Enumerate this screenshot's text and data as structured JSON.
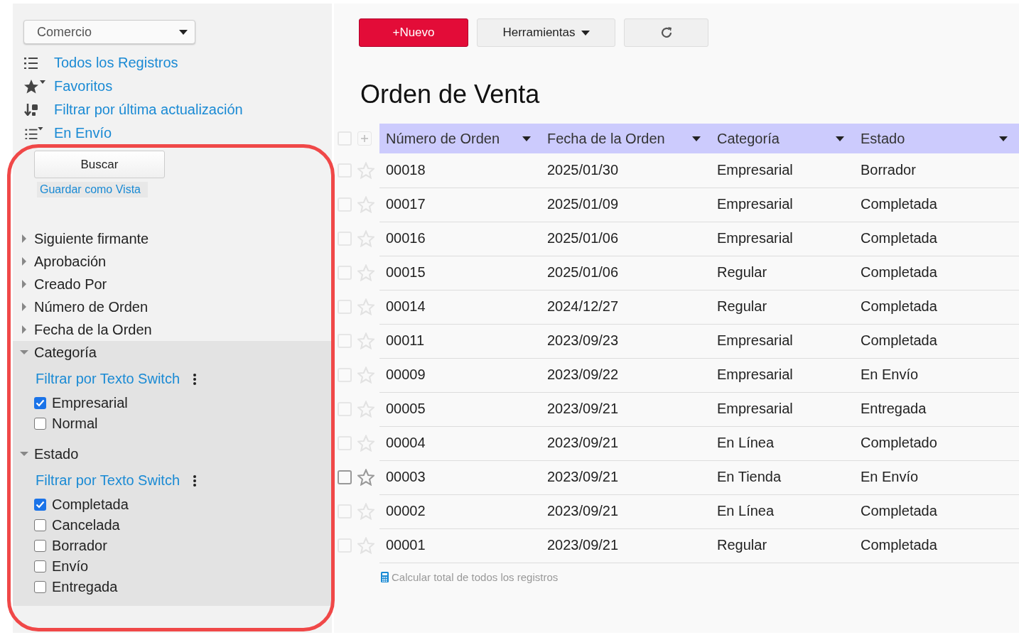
{
  "sidebar": {
    "app_select": {
      "value": "Comercio"
    },
    "nav": [
      {
        "kind": "list",
        "label": "Todos los Registros"
      },
      {
        "kind": "star",
        "label": "Favoritos"
      },
      {
        "kind": "sort",
        "label": "Filtrar por última actualización"
      },
      {
        "kind": "listfilter",
        "label": "En Envío"
      }
    ],
    "search_button": "Buscar",
    "save_view": "Guardar como Vista",
    "filters": [
      {
        "label": "Siguiente firmante",
        "expanded": false
      },
      {
        "label": "Aprobación",
        "expanded": false
      },
      {
        "label": "Creado Por",
        "expanded": false
      },
      {
        "label": "Número de Orden",
        "expanded": false
      },
      {
        "label": "Fecha de la Orden",
        "expanded": false
      },
      {
        "label": "Categoría",
        "expanded": true,
        "switch_label": "Filtrar por Texto Switch",
        "options": [
          {
            "label": "Empresarial",
            "checked": true
          },
          {
            "label": "Normal",
            "checked": false
          }
        ]
      },
      {
        "label": "Estado",
        "expanded": true,
        "switch_label": "Filtrar por Texto Switch",
        "options": [
          {
            "label": "Completada",
            "checked": true
          },
          {
            "label": "Cancelada",
            "checked": false
          },
          {
            "label": "Borrador",
            "checked": false
          },
          {
            "label": "Envío",
            "checked": false
          },
          {
            "label": "Entregada",
            "checked": false
          }
        ]
      }
    ]
  },
  "toolbar": {
    "new_button": "+Nuevo",
    "tools_button": "Herramientas"
  },
  "title": "Orden de Venta",
  "table": {
    "columns": [
      "Número de Orden",
      "Fecha de la Orden",
      "Categoría",
      "Estado"
    ],
    "select_all": {
      "checked": false
    },
    "rows": [
      {
        "cells": [
          "00018",
          "2025/01/30",
          "Empresarial",
          "Borrador"
        ],
        "checked": false,
        "hovered": false
      },
      {
        "cells": [
          "00017",
          "2025/01/09",
          "Empresarial",
          "Completada"
        ],
        "checked": false,
        "hovered": false
      },
      {
        "cells": [
          "00016",
          "2025/01/06",
          "Empresarial",
          "Completada"
        ],
        "checked": false,
        "hovered": false
      },
      {
        "cells": [
          "00015",
          "2025/01/06",
          "Regular",
          "Completada"
        ],
        "checked": false,
        "hovered": false
      },
      {
        "cells": [
          "00014",
          "2024/12/27",
          "Regular",
          "Completada"
        ],
        "checked": false,
        "hovered": false
      },
      {
        "cells": [
          "00011",
          "2023/09/23",
          "Empresarial",
          "Completada"
        ],
        "checked": false,
        "hovered": false
      },
      {
        "cells": [
          "00009",
          "2023/09/22",
          "Empresarial",
          "En Envío"
        ],
        "checked": false,
        "hovered": false
      },
      {
        "cells": [
          "00005",
          "2023/09/21",
          "Empresarial",
          "Entregada"
        ],
        "checked": false,
        "hovered": false
      },
      {
        "cells": [
          "00004",
          "2023/09/21",
          "En Línea",
          "Completado"
        ],
        "checked": false,
        "hovered": false
      },
      {
        "cells": [
          "00003",
          "2023/09/21",
          "En Tienda",
          "En Envío"
        ],
        "checked": false,
        "hovered": true
      },
      {
        "cells": [
          "00002",
          "2023/09/21",
          "En Línea",
          "Completada"
        ],
        "checked": false,
        "hovered": false
      },
      {
        "cells": [
          "00001",
          "2023/09/21",
          "Regular",
          "Completada"
        ],
        "checked": false,
        "hovered": false
      }
    ],
    "footer_link": "Calcular total de todos los registros"
  }
}
